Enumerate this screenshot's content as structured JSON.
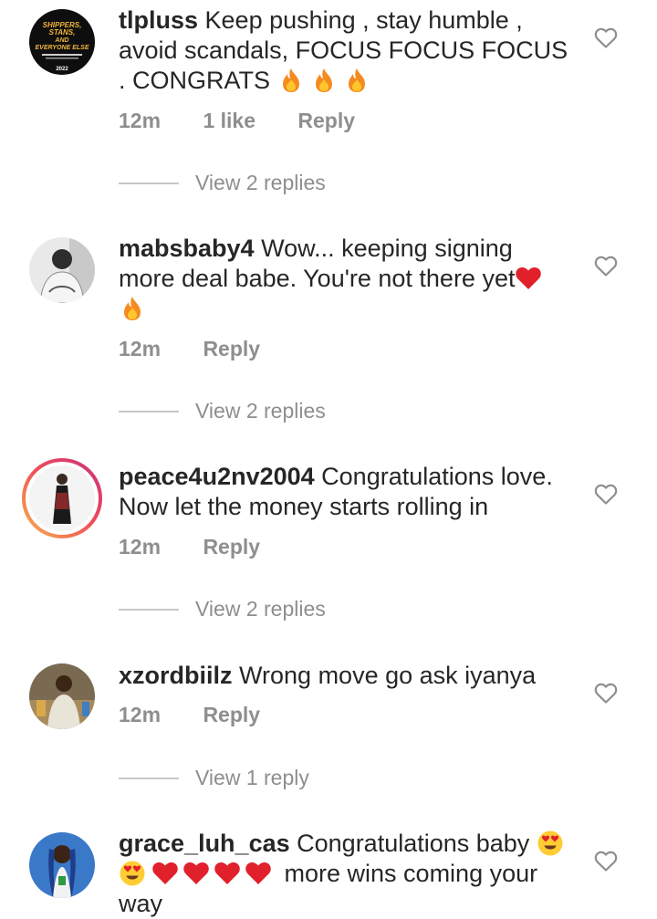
{
  "comments": [
    {
      "username": "tlpluss",
      "text": "Keep pushing , stay humble , avoid scandals,  FOCUS FOCUS FOCUS . CONGRATS",
      "time": "12m",
      "likes": "1 like",
      "reply": "Reply",
      "view_replies": "View 2 replies",
      "avatar_text": [
        "SHIPPERS,",
        "STANS,",
        "AND",
        "EVERYONE ELSE",
        "2022"
      ]
    },
    {
      "username": "mabsbaby4",
      "text": "Wow... keeping signing more deal babe. You're not there yet",
      "time": "12m",
      "reply": "Reply",
      "view_replies": "View 2 replies"
    },
    {
      "username": "peace4u2nv2004",
      "text": "Congratulations love. Now let the money starts rolling in",
      "time": "12m",
      "reply": "Reply",
      "view_replies": "View 2 replies"
    },
    {
      "username": "xzordbiilz",
      "text": "Wrong move go ask iyanya",
      "time": "12m",
      "reply": "Reply",
      "view_replies": "View 1 reply"
    },
    {
      "username": "grace_luh_cas",
      "text": "Congratulations baby",
      "text_tail": "more wins coming your way"
    }
  ],
  "colors": {
    "text": "#262626",
    "secondary": "#8e8e8e",
    "heart_red": "#e0202b",
    "fire_orange": "#f58a1f"
  },
  "icons": {
    "like": "heart-outline-icon",
    "fire": "fire-emoji",
    "red_heart": "red-heart-emoji",
    "heart_eyes": "heart-eyes-emoji"
  }
}
